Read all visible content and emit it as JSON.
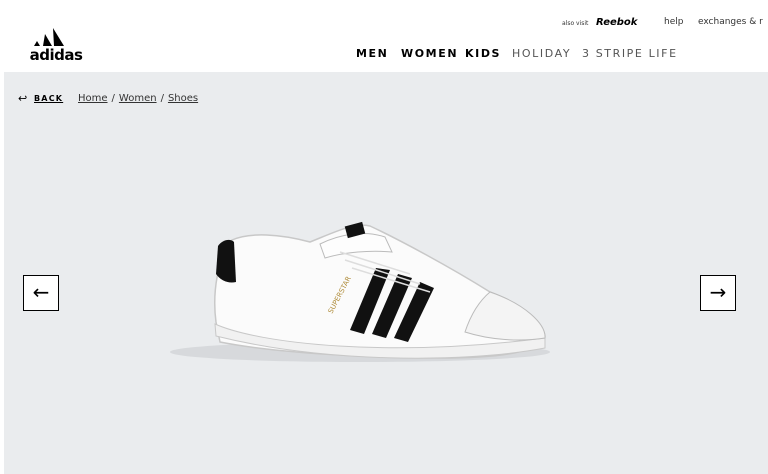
{
  "brand": {
    "name": "adidas"
  },
  "utility": {
    "also_visit": "also visit",
    "reebok": "Reebok",
    "help": "help",
    "exchanges": "exchanges & r"
  },
  "nav": {
    "men": "MEN",
    "women": "WOMEN",
    "kids": "KIDS",
    "holiday": "HOLIDAY",
    "stripe_life": "3 STRIPE LIFE"
  },
  "breadcrumb": {
    "back": "BACK",
    "items": [
      "Home",
      "Women",
      "Shoes"
    ],
    "separator": "/"
  },
  "product": {
    "model_text": "SUPERSTAR"
  },
  "gallery": {
    "prev_glyph": "←",
    "next_glyph": "→"
  },
  "colors": {
    "background": "#eaecee",
    "accent": "#000000"
  }
}
